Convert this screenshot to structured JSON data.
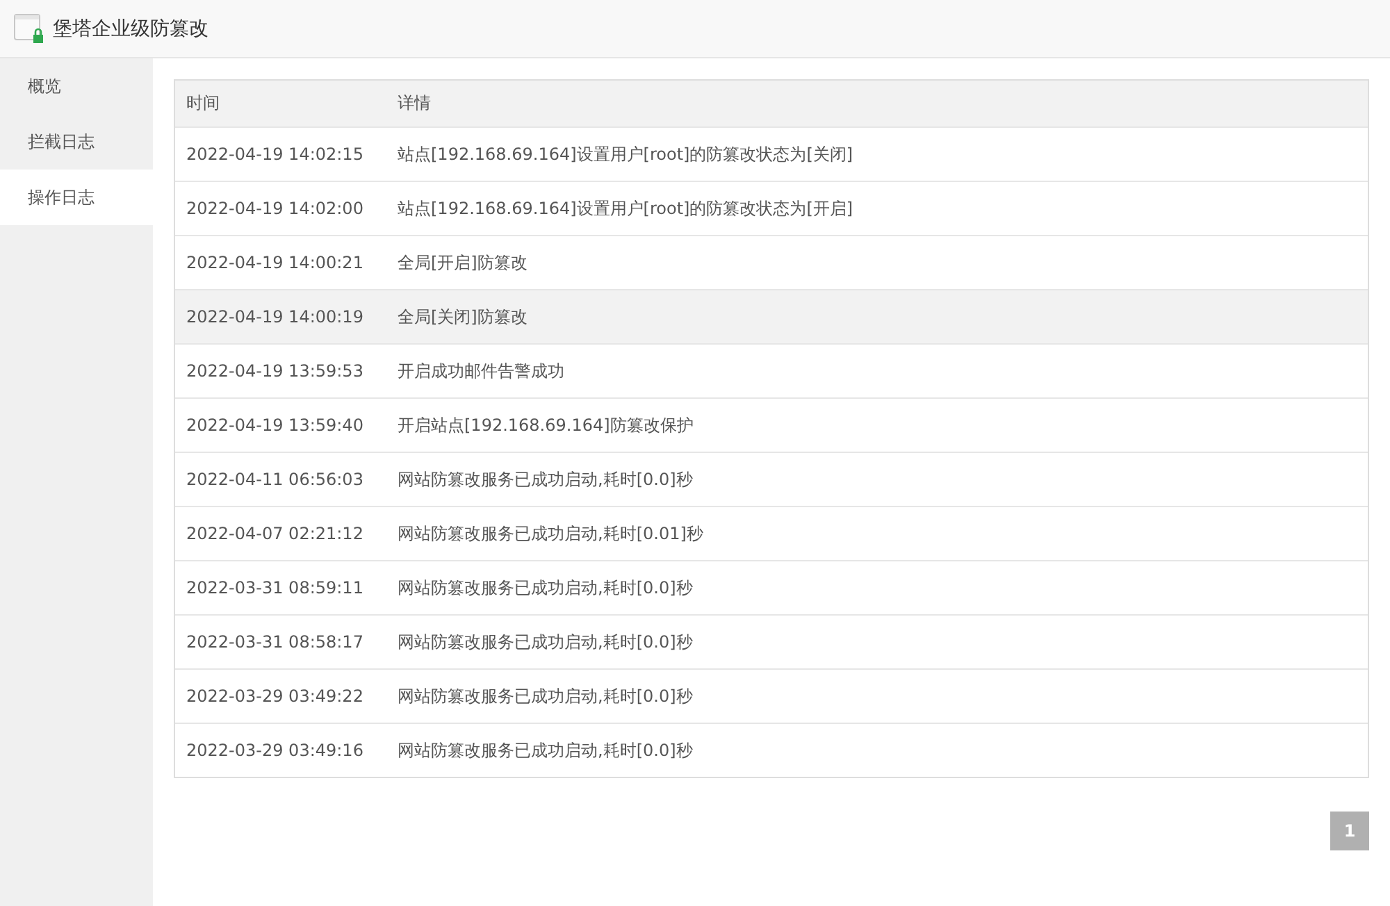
{
  "window": {
    "title": "堡塔企业级防篡改"
  },
  "sidebar": {
    "items": [
      {
        "label": "概览",
        "selected": false
      },
      {
        "label": "拦截日志",
        "selected": false
      },
      {
        "label": "操作日志",
        "selected": true
      }
    ]
  },
  "table": {
    "columns": [
      "时间",
      "详情"
    ],
    "rows": [
      {
        "time": "2022-04-19 14:02:15",
        "detail": "站点[192.168.69.164]设置用户[root]的防篡改状态为[关闭]",
        "selected": false
      },
      {
        "time": "2022-04-19 14:02:00",
        "detail": "站点[192.168.69.164]设置用户[root]的防篡改状态为[开启]",
        "selected": false
      },
      {
        "time": "2022-04-19 14:00:21",
        "detail": "全局[开启]防篡改",
        "selected": false
      },
      {
        "time": "2022-04-19 14:00:19",
        "detail": "全局[关闭]防篡改",
        "selected": true
      },
      {
        "time": "2022-04-19 13:59:53",
        "detail": "开启成功邮件告警成功",
        "selected": false
      },
      {
        "time": "2022-04-19 13:59:40",
        "detail": "开启站点[192.168.69.164]防篡改保护",
        "selected": false
      },
      {
        "time": "2022-04-11 06:56:03",
        "detail": "网站防篡改服务已成功启动,耗时[0.0]秒",
        "selected": false
      },
      {
        "time": "2022-04-07 02:21:12",
        "detail": "网站防篡改服务已成功启动,耗时[0.01]秒",
        "selected": false
      },
      {
        "time": "2022-03-31 08:59:11",
        "detail": "网站防篡改服务已成功启动,耗时[0.0]秒",
        "selected": false
      },
      {
        "time": "2022-03-31 08:58:17",
        "detail": "网站防篡改服务已成功启动,耗时[0.0]秒",
        "selected": false
      },
      {
        "time": "2022-03-29 03:49:22",
        "detail": "网站防篡改服务已成功启动,耗时[0.0]秒",
        "selected": false
      },
      {
        "time": "2022-03-29 03:49:16",
        "detail": "网站防篡改服务已成功启动,耗时[0.0]秒",
        "selected": false
      }
    ]
  },
  "pagination": {
    "pages": [
      {
        "label": "1",
        "selected": true
      }
    ]
  }
}
